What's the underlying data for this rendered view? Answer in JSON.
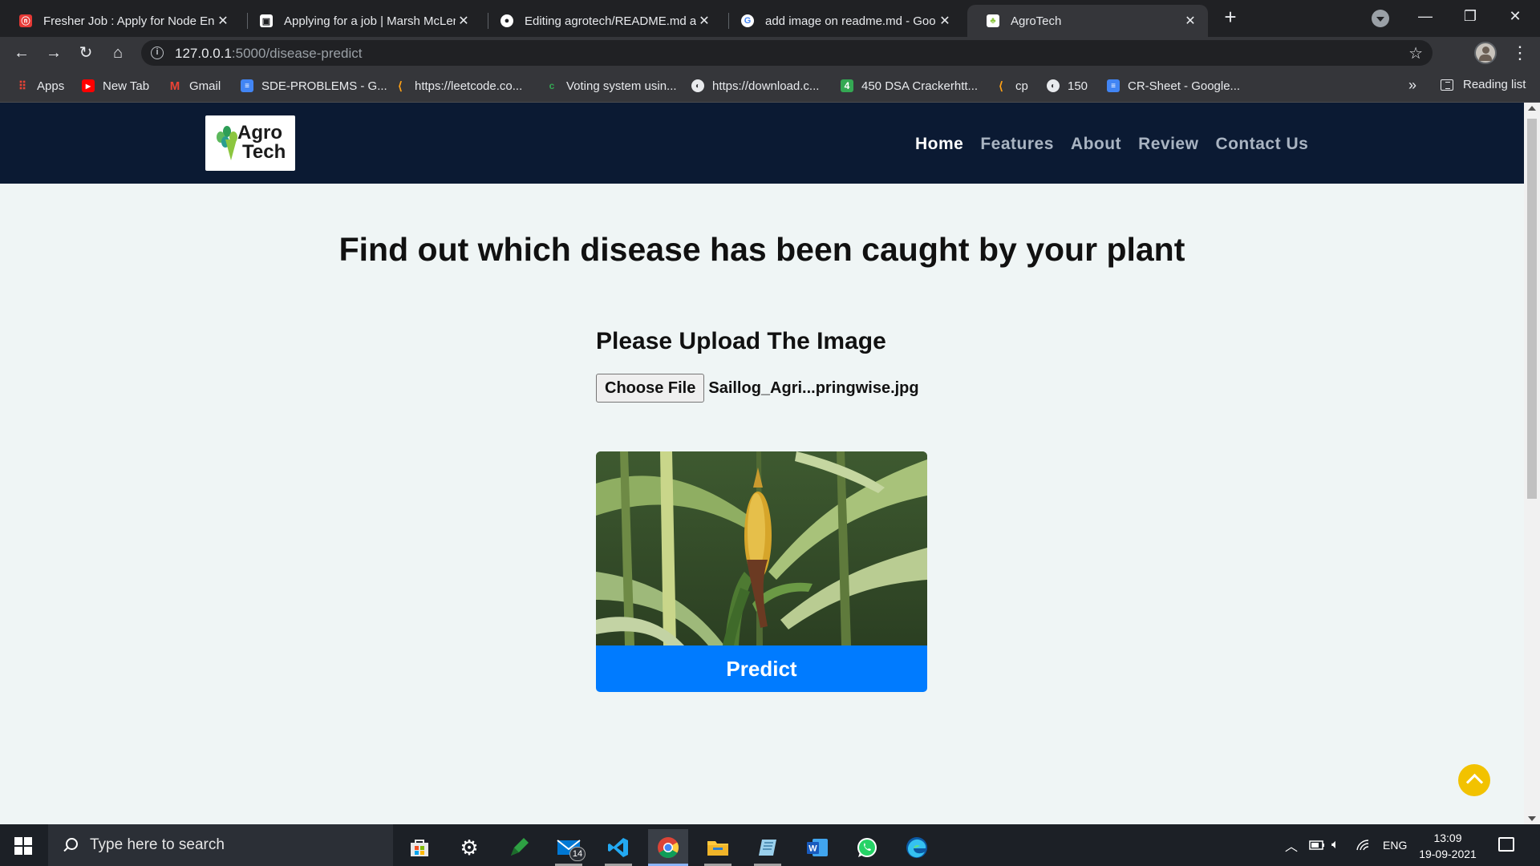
{
  "browser": {
    "tabs": [
      {
        "title": "Fresher Job : Apply for Node Eng",
        "icon": "naukri-icon",
        "color": "#e53935"
      },
      {
        "title": "Applying for a job | Marsh McLen",
        "icon": "briefcase-icon",
        "color": "#ffffff"
      },
      {
        "title": "Editing agrotech/README.md at",
        "icon": "github-icon",
        "color": "#ffffff"
      },
      {
        "title": "add image on readme.md - Goo",
        "icon": "google-icon",
        "color": "#4285f4"
      },
      {
        "title": "AgroTech",
        "icon": "agrotech-favicon",
        "color": "#8cc63f"
      }
    ],
    "active_tab_index": 4,
    "url_host": "127.0.0.1",
    "url_path": ":5000/disease-predict",
    "bookmarks": [
      {
        "label": "Apps",
        "icon": "apps-grid-icon",
        "color": "#ea4335"
      },
      {
        "label": "New Tab",
        "icon": "youtube-icon",
        "color": "#ff0000"
      },
      {
        "label": "Gmail",
        "icon": "gmail-icon",
        "color": "#ea4335"
      },
      {
        "label": "SDE-PROBLEMS - G...",
        "icon": "docs-icon",
        "color": "#4285f4"
      },
      {
        "label": "https://leetcode.co...",
        "icon": "leetcode-icon",
        "color": "#ffa116"
      },
      {
        "label": "Voting system usin...",
        "icon": "c-icon",
        "color": "#34a853"
      },
      {
        "label": "https://download.c...",
        "icon": "globe-icon",
        "color": "#e8eaed"
      },
      {
        "label": "450 DSA Crackerhtt...",
        "icon": "number-4-icon",
        "color": "#34a853"
      },
      {
        "label": "cp",
        "icon": "leetcode-icon",
        "color": "#ffa116"
      },
      {
        "label": "150",
        "icon": "globe-icon",
        "color": "#e8eaed"
      },
      {
        "label": "CR-Sheet - Google...",
        "icon": "docs-icon",
        "color": "#4285f4"
      }
    ],
    "bookmarks_more": "»",
    "reading_list": "Reading list"
  },
  "site": {
    "logo_line1": "Agro",
    "logo_line2": "Tech",
    "nav": [
      {
        "label": "Home",
        "active": true
      },
      {
        "label": "Features",
        "active": false
      },
      {
        "label": "About",
        "active": false
      },
      {
        "label": "Review",
        "active": false
      },
      {
        "label": "Contact Us",
        "active": false
      }
    ],
    "heading": "Find out which disease has been caught by your plant",
    "upload_heading": "Please Upload The Image",
    "choose_file_label": "Choose File",
    "file_name": "Saillog_Agri...pringwise.jpg",
    "predict_label": "Predict",
    "accent_color": "#007bff",
    "nav_bg": "#0b1a33"
  },
  "taskbar": {
    "search_placeholder": "Type here to search",
    "mail_badge": "14",
    "language": "ENG",
    "time": "13:09",
    "date": "19-09-2021"
  }
}
